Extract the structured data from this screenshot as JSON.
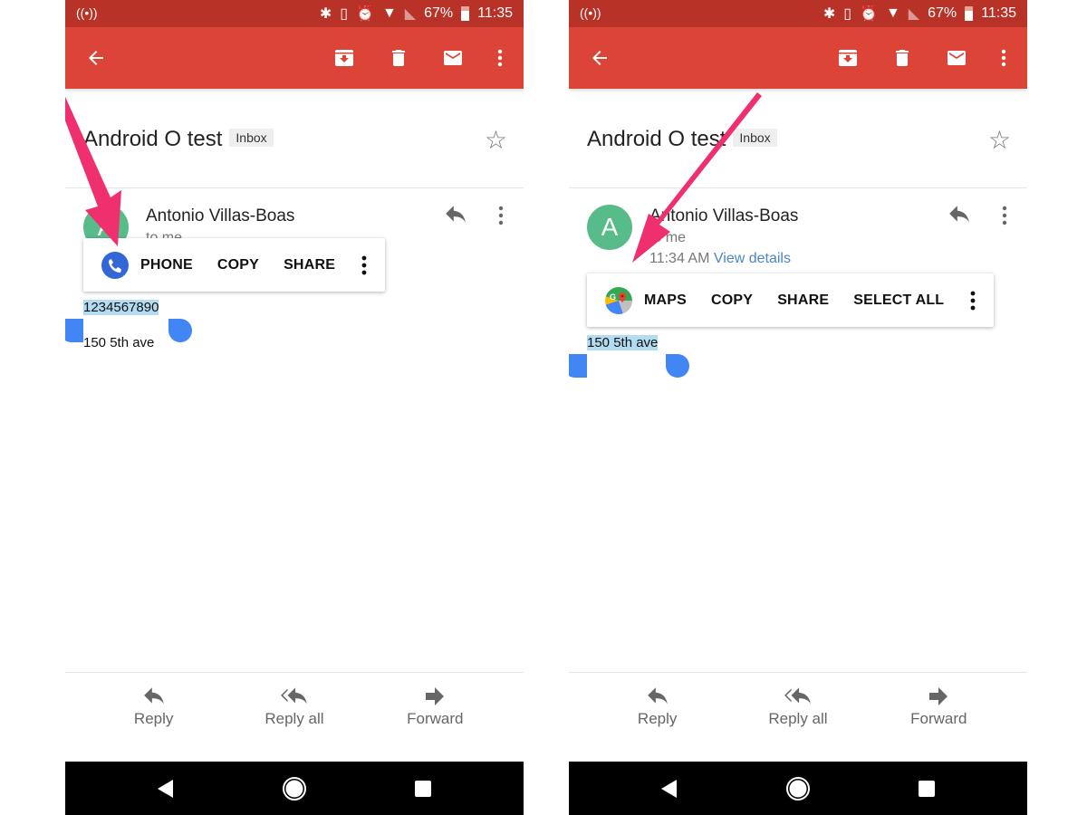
{
  "colors": {
    "status_bar": "#b83227",
    "toolbar": "#db4437",
    "accent_link": "#4a86c8",
    "selection": "#b3dcf2",
    "handle": "#4285f4",
    "annotation_arrow": "#f0306e",
    "avatar": "#57bb8a"
  },
  "phones": [
    {
      "status": {
        "battery": "67%",
        "time": "11:35"
      },
      "subject": "Android O test",
      "label": "Inbox",
      "sender": "Antonio Villas-Boas",
      "avatar_letter": "A",
      "recipient": "to me",
      "time": "",
      "view_details": "",
      "popup": {
        "app_icon": "phone-icon",
        "items": [
          "PHONE",
          "COPY",
          "SHARE"
        ]
      },
      "body": [
        "1234567890",
        "150 5th ave"
      ],
      "selected_line": 0,
      "actions": {
        "reply": "Reply",
        "reply_all": "Reply all",
        "forward": "Forward"
      }
    },
    {
      "status": {
        "battery": "67%",
        "time": "11:35"
      },
      "subject": "Android O test",
      "label": "Inbox",
      "sender": "Antonio Villas-Boas",
      "avatar_letter": "A",
      "recipient": "to me",
      "time": "11:34 AM",
      "view_details": "View details",
      "popup": {
        "app_icon": "maps-icon",
        "items": [
          "MAPS",
          "COPY",
          "SHARE",
          "SELECT ALL"
        ]
      },
      "body": [
        "150 5th ave"
      ],
      "selected_line": 0,
      "actions": {
        "reply": "Reply",
        "reply_all": "Reply all",
        "forward": "Forward"
      }
    }
  ]
}
